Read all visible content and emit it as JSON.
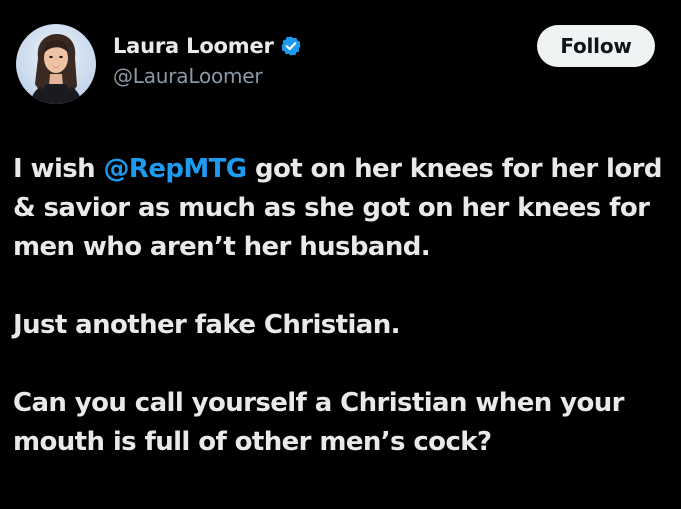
{
  "author": {
    "display_name": "Laura Loomer",
    "handle": "@LauraLoomer",
    "verified_badge_color": "#1d9bf0",
    "avatar_icon": "profile-photo"
  },
  "follow_button": {
    "label": "Follow"
  },
  "tweet": {
    "para1": {
      "before": "I wish ",
      "mention": "@RepMTG",
      "after": " got on her knees for her lord & savior as much as she got on her knees for men who aren’t her husband."
    },
    "para2": "Just another fake Christian.",
    "para3": "Can you call yourself a Christian when your mouth is full of other men’s cock?"
  },
  "colors": {
    "background": "#000000",
    "text": "#e7e9ea",
    "secondary_text": "#8b98a5",
    "mention": "#1d9bf0"
  }
}
